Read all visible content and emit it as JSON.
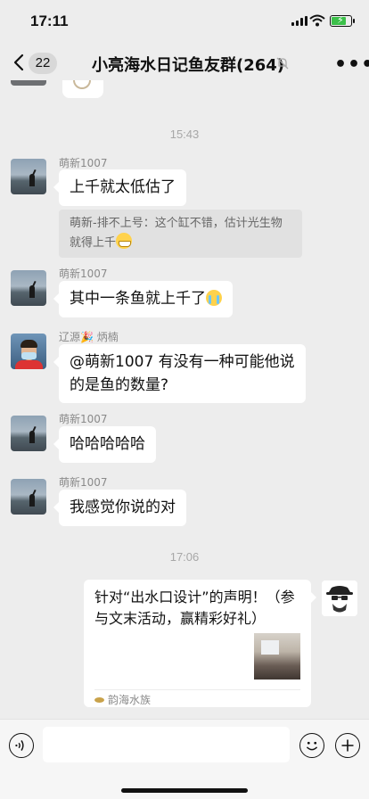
{
  "status_bar": {
    "time": "17:11",
    "battery_color": "#3cc04a"
  },
  "nav": {
    "back_icon": "chevron-left-icon",
    "unread_count": "22",
    "title": "小亮海水日记鱼友群(264)",
    "mute_icon": "bell-off-icon",
    "more_icon": "more-icon"
  },
  "chat": {
    "timestamp_1": "15:43",
    "messages": [
      {
        "sender": "萌新1007",
        "text": "上千就太低估了",
        "quote_text": "萌新-排不上号：这个缸不错，估计光生物就得上千"
      },
      {
        "sender": "萌新1007",
        "text": "其中一条鱼就上千了"
      },
      {
        "sender": "辽源🎉 炳楠",
        "text_line1": "@萌新1007 有没有一种可能他说",
        "text_line2": "的是鱼的数量?"
      },
      {
        "sender": "萌新1007",
        "text": "哈哈哈哈哈"
      },
      {
        "sender": "萌新1007",
        "text": "我感觉你说的对"
      }
    ],
    "timestamp_2": "17:06",
    "link_card": {
      "title": "针对“出水口设计”的声明！（参与文末活动，赢精彩好礼）",
      "source": "韵海水族"
    }
  },
  "input_bar": {
    "voice_icon": "voice-icon",
    "emoji_icon": "smiley-icon",
    "plus_icon": "plus-icon"
  },
  "colors": {
    "background": "#ededed",
    "bubble": "#ffffff",
    "timestamp": "#a7a7a7"
  }
}
